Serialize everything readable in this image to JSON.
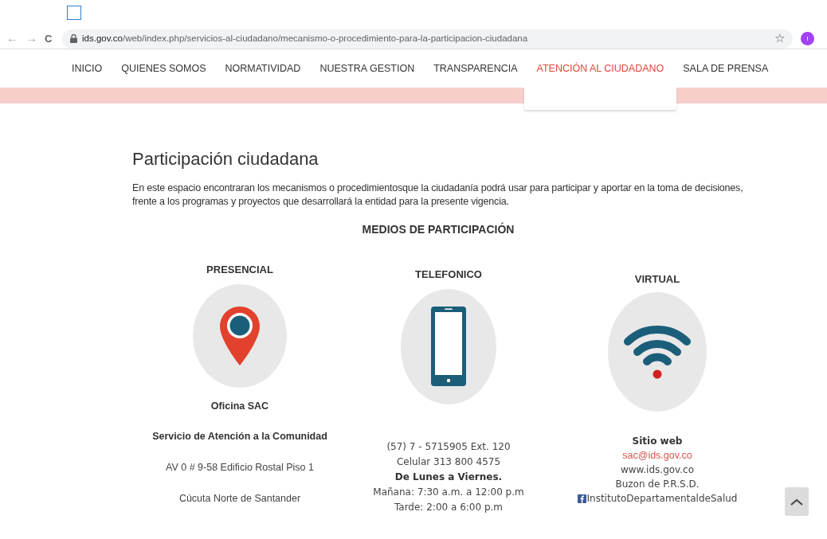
{
  "browser": {
    "url_host": "ids.gov.co",
    "url_path": "/web/index.php/servicios-al-ciudadano/mecanismo-o-procedimiento-para-la-participacion-ciudadana",
    "back": "←",
    "forward": "→",
    "reload": "C",
    "bookmark": "☆",
    "profile": "I"
  },
  "nav": [
    {
      "label": "INICIO",
      "selected": false
    },
    {
      "label": "QUIENES SOMOS",
      "selected": false
    },
    {
      "label": "NORMATIVIDAD",
      "selected": false
    },
    {
      "label": "NUESTRA GESTION",
      "selected": false
    },
    {
      "label": "TRANSPARENCIA",
      "selected": false
    },
    {
      "label": "ATENCIÓN AL CIUDADANO",
      "selected": true
    },
    {
      "label": "SALA DE PRENSA",
      "selected": false
    }
  ],
  "page": {
    "title": "Participación ciudadana",
    "intro": "En este espacio encontraran los mecanismos o procedimientosque la ciudadanía podrá usar para participar y aportar en la toma de decisiones, frente a los programas y proyectos que desarrollará la entidad para la presente vigencia.",
    "section_title": "MEDIOS DE PARTICIPACIÓN"
  },
  "channels": [
    {
      "title": "PRESENCIAL",
      "kind": "pin",
      "lines": [
        {
          "kind": "heading",
          "text": "Oficina SAC"
        },
        {
          "kind": "heading",
          "text": "Servicio de Atención a la Comunidad"
        },
        {
          "kind": "plain",
          "text": "AV 0 # 9-58 Edificio Rostal Piso 1"
        },
        {
          "kind": "plain",
          "text": "Cúcuta Norte de Santander"
        }
      ]
    },
    {
      "title": "TELEFONICO",
      "kind": "phone",
      "lines": [
        {
          "kind": "plain",
          "text": "(57) 7 - 5715905 Ext. 120"
        },
        {
          "kind": "plain",
          "text": "Celular 313 800 4575"
        },
        {
          "kind": "heading",
          "text": "De Lunes a Viernes."
        },
        {
          "kind": "plain",
          "text": "Mañana: 7:30 a.m. a 12:00 p.m"
        },
        {
          "kind": "plain",
          "text": "Tarde: 2:00 a 6:00 p.m"
        }
      ]
    },
    {
      "title": "VIRTUAL",
      "kind": "wifi",
      "lines": [
        {
          "kind": "heading",
          "text": "Sitio web"
        },
        {
          "kind": "link",
          "text": "sac@ids.gov.co"
        },
        {
          "kind": "plain",
          "text": "www.ids.gov.co"
        },
        {
          "kind": "plain",
          "text": "Buzon de P.R.S.D."
        },
        {
          "kind": "facebook",
          "text": "InstitutoDepartamentaldeSalud"
        }
      ]
    }
  ]
}
